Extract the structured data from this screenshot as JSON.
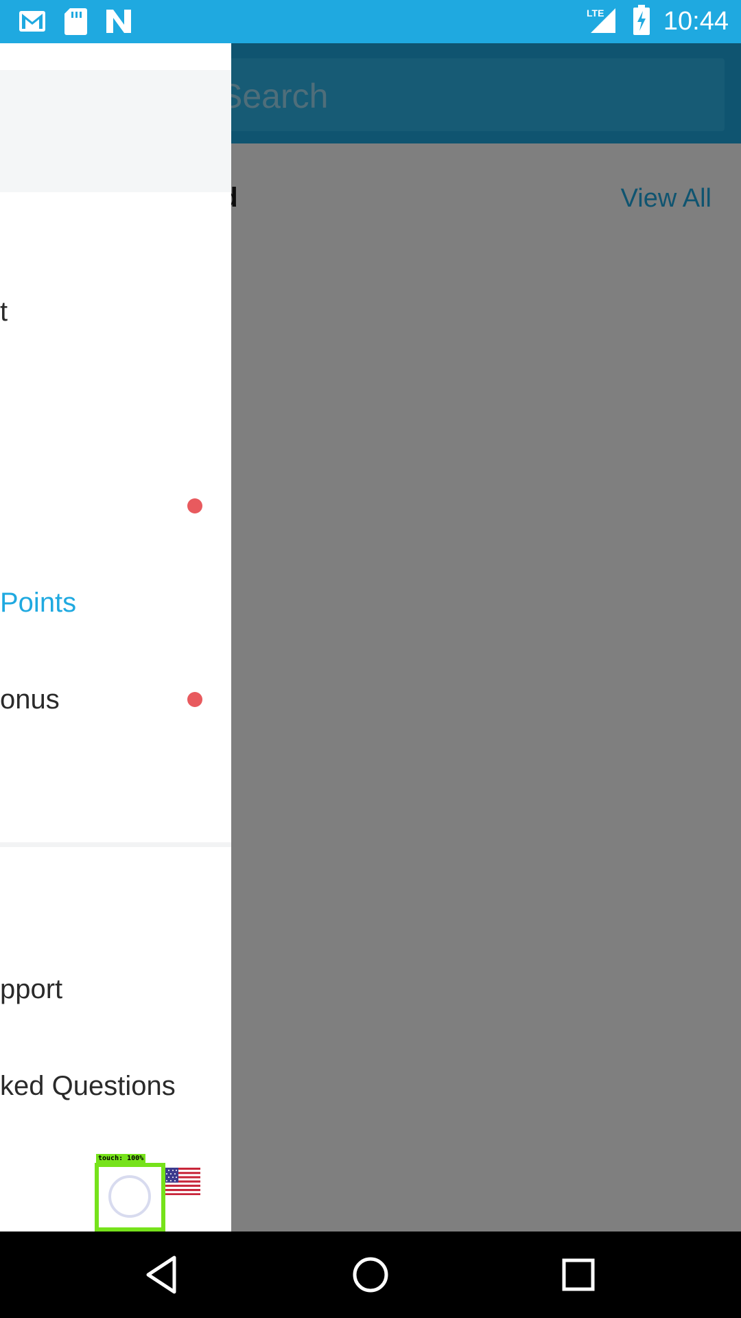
{
  "status_bar": {
    "time": "10:44",
    "left_icons": [
      "gmail-icon",
      "sd-card-icon",
      "n-app-icon"
    ],
    "right_icons": [
      "lte-signal-icon",
      "battery-charging-icon"
    ],
    "network": "LTE",
    "color": "#1fa9e0"
  },
  "background_app": {
    "search_placeholder": "Search",
    "section_title_partial": "ed",
    "view_all_label": "View All"
  },
  "drawer": {
    "items": [
      {
        "label": "t",
        "active": false,
        "has_dot": false
      },
      {
        "label": "",
        "active": false,
        "has_dot": true
      },
      {
        "label": "Points",
        "active": true,
        "has_dot": false
      },
      {
        "label": "onus",
        "active": false,
        "has_dot": true
      },
      {
        "label": "pport",
        "active": false,
        "has_dot": false
      },
      {
        "label": "ked Questions",
        "active": false,
        "has_dot": false
      }
    ],
    "accent_color": "#1fa9e0",
    "dot_color": "#e85a5e",
    "language_flag": "us-flag-icon"
  },
  "touch_overlay": {
    "label": "touch: 100%"
  },
  "nav_bar": {
    "buttons": [
      "back-icon",
      "home-icon",
      "recents-icon"
    ]
  }
}
